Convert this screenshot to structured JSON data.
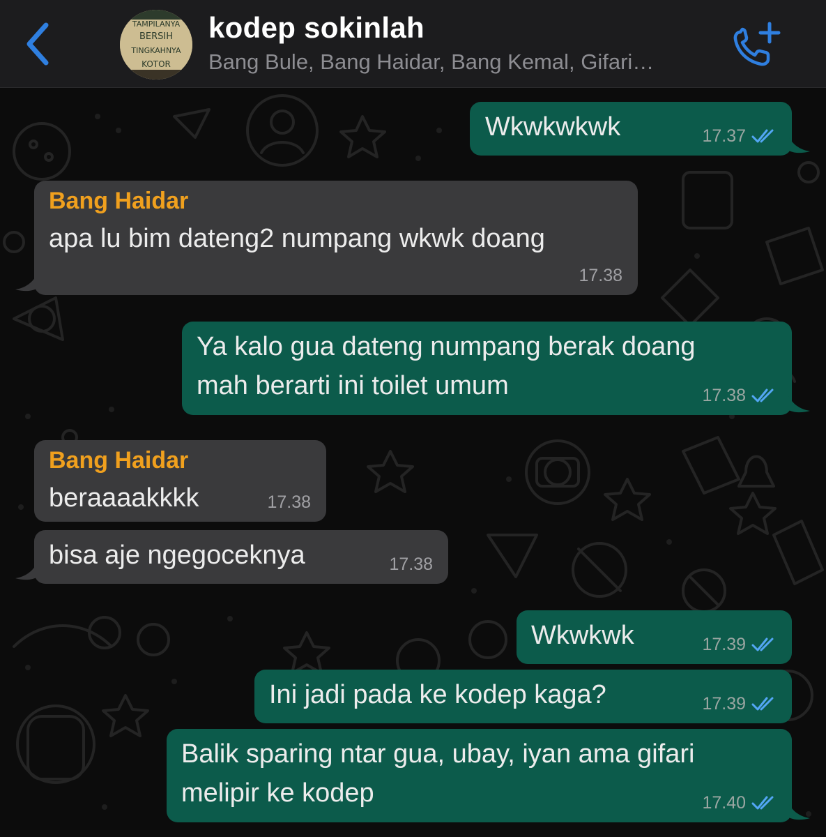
{
  "header": {
    "title": "kodep sokinlah",
    "subtitle": "Bang Bule, Bang Haidar, Bang Kemal, Gifari…",
    "avatar_text": [
      "TAMPILANYA",
      "BERSIH",
      "TINGKAHNYA",
      "KOTOR"
    ]
  },
  "icons": {
    "back": "chevron-left-icon",
    "call": "phone-add-icon",
    "read_receipt": "double-check-icon"
  },
  "colors": {
    "accent_blue": "#2f7fe0",
    "outgoing_bubble": "#0c5b4b",
    "incoming_bubble": "#3a3a3c",
    "sender_name": "#f0a01e",
    "read_tick": "#53a6f4"
  },
  "messages": [
    {
      "dir": "out",
      "text": "Wkwkwkwk",
      "time": "17.37",
      "read": true
    },
    {
      "dir": "in",
      "sender": "Bang Haidar",
      "text": "apa lu bim dateng2 numpang wkwk doang",
      "time": "17.38"
    },
    {
      "dir": "out",
      "text": "Ya kalo gua dateng numpang berak doang\nmah berarti ini toilet umum",
      "time": "17.38",
      "read": true
    },
    {
      "dir": "in",
      "sender": "Bang Haidar",
      "text": "beraaaakkkk",
      "time": "17.38"
    },
    {
      "dir": "in",
      "text": "bisa aje ngegoceknya",
      "time": "17.38"
    },
    {
      "dir": "out",
      "text": "Wkwkwk",
      "time": "17.39",
      "read": true
    },
    {
      "dir": "out",
      "text": "Ini jadi pada ke kodep kaga?",
      "time": "17.39",
      "read": true
    },
    {
      "dir": "out",
      "text": "Balik sparing ntar gua, ubay, iyan ama gifari\nmelipir ke kodep",
      "time": "17.40",
      "read": true
    }
  ]
}
